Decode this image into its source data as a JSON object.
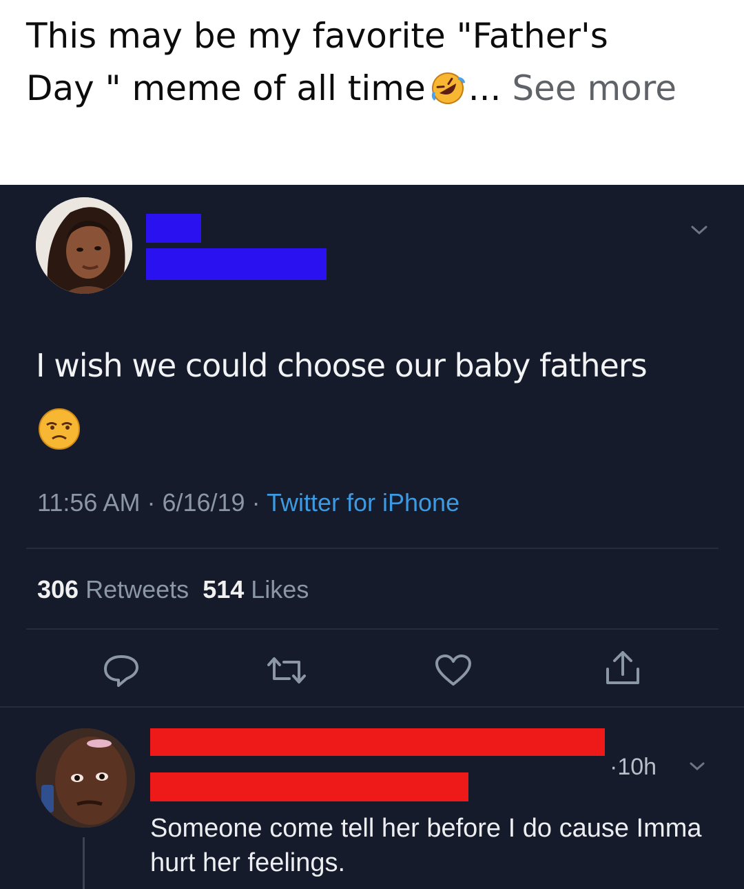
{
  "post": {
    "caption_line1": "This may be my favorite \"Father's",
    "caption_line2": "Day \" meme of all time",
    "ellipsis": "...",
    "see_more": "See more",
    "emoji": "rolling-on-floor-laughing-icon"
  },
  "tweet": {
    "avatar": "profile-avatar",
    "text": "I wish we could choose our baby fathers",
    "emoji": "unamused-face-icon",
    "time": "11:56 AM",
    "date": "6/16/19",
    "source": "Twitter for iPhone",
    "separator": "·",
    "retweets_count": "306",
    "retweets_label": "Retweets",
    "likes_count": "514",
    "likes_label": "Likes",
    "colors": {
      "background": "#161b2b",
      "link": "#3d9ae0",
      "redaction": "#2a12f0"
    }
  },
  "actions": [
    "reply-icon",
    "retweet-icon",
    "like-icon",
    "share-icon"
  ],
  "reply": {
    "avatar": "reply-avatar",
    "age": "·10h",
    "text": "Someone come tell her before I do cause Imma hurt her feelings.",
    "redaction_color": "#ee1a1a"
  }
}
